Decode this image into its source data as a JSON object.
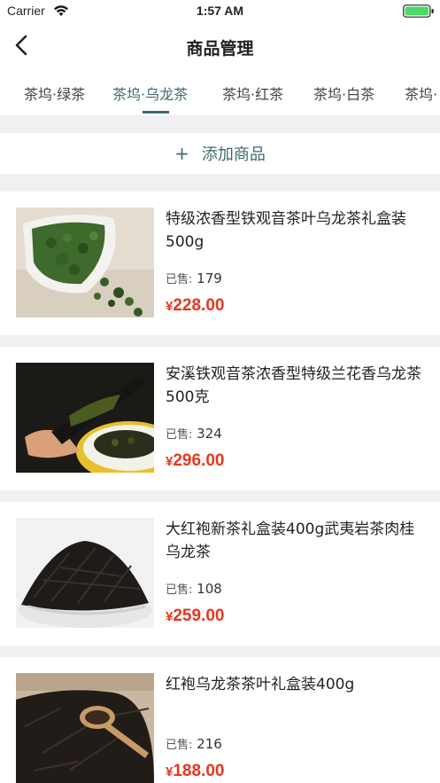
{
  "status_bar": {
    "carrier": "Carrier",
    "time": "1:57 AM",
    "wifi_icon": "wifi-icon",
    "battery_icon": "battery-icon"
  },
  "nav": {
    "back_icon": "chevron-left-icon",
    "title": "商品管理"
  },
  "tabs": [
    {
      "label": "茶坞·绿茶",
      "active": false
    },
    {
      "label": "茶坞·乌龙茶",
      "active": true
    },
    {
      "label": "茶坞·红茶",
      "active": false
    },
    {
      "label": "茶坞·白茶",
      "active": false
    },
    {
      "label": "茶坞·",
      "active": false
    }
  ],
  "add_product": {
    "icon": "plus",
    "label": "添加商品"
  },
  "products": [
    {
      "title": "特级浓香型铁观音茶叶乌龙茶礼盒装500g",
      "sold_label": "已售:",
      "sold_count": "179",
      "currency": "¥",
      "price": "228.00"
    },
    {
      "title": "安溪铁观音茶浓香型特级兰花香乌龙茶500克",
      "sold_label": "已售:",
      "sold_count": "324",
      "currency": "¥",
      "price": "296.00"
    },
    {
      "title": "大红袍新茶礼盒装400g武夷岩茶肉桂乌龙茶",
      "sold_label": "已售:",
      "sold_count": "108",
      "currency": "¥",
      "price": "259.00"
    },
    {
      "title": "红袍乌龙茶茶叶礼盒装400g",
      "sold_label": "已售:",
      "sold_count": "216",
      "currency": "¥",
      "price": "188.00"
    }
  ],
  "colors": {
    "accent": "#3d6b6e",
    "price": "#e8361d",
    "background": "#f0f0f3",
    "battery": "#4cd964"
  }
}
